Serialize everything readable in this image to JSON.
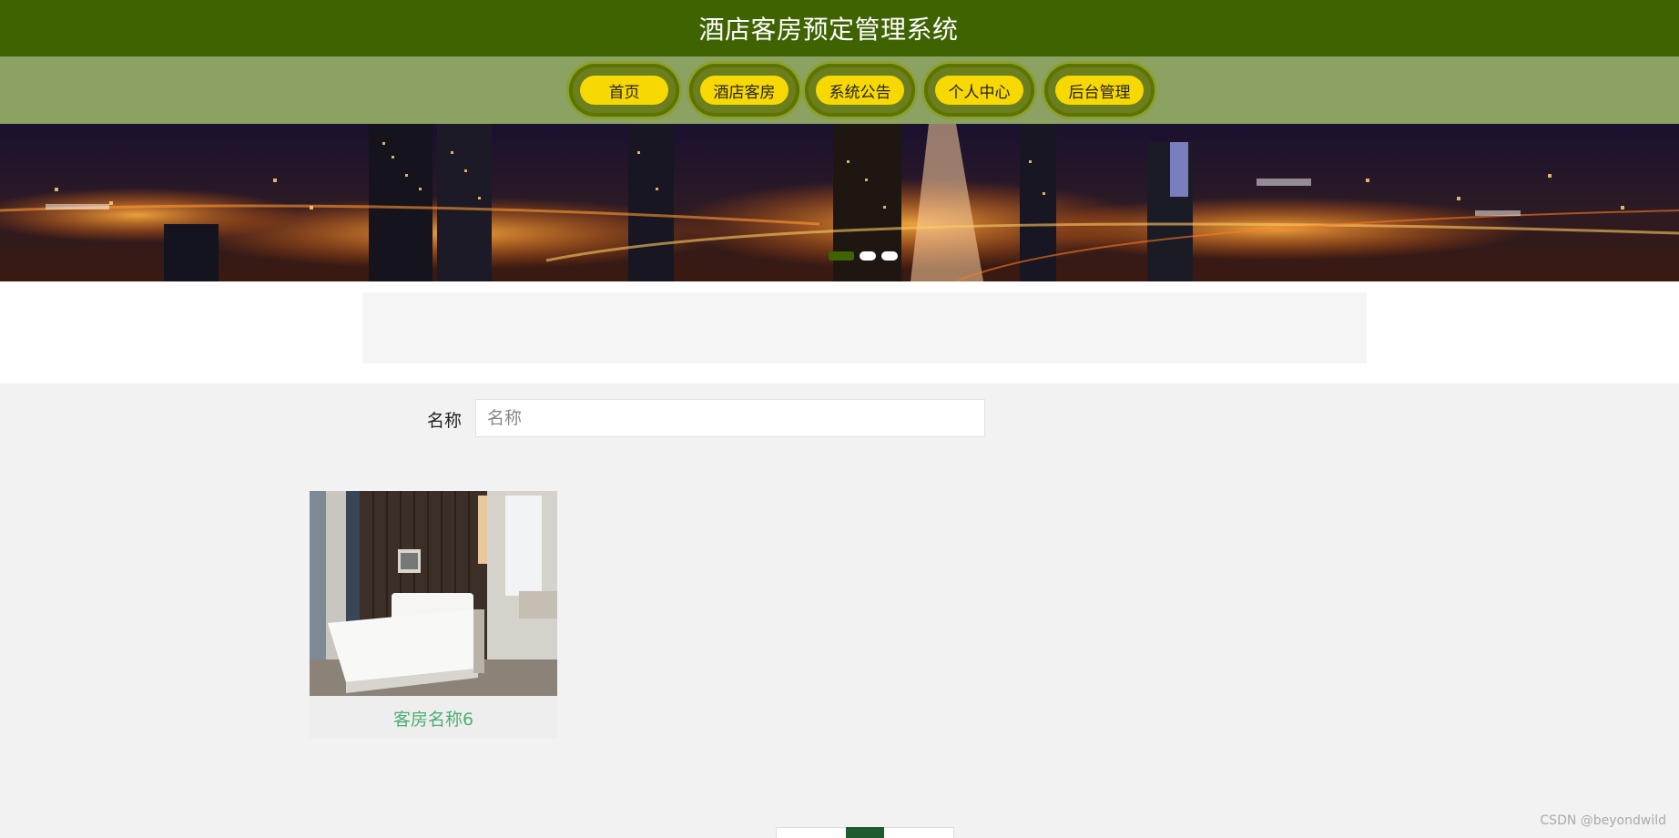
{
  "header": {
    "title": "酒店客房预定管理系统"
  },
  "nav": {
    "items": [
      {
        "label": "首页"
      },
      {
        "label": "酒店客房"
      },
      {
        "label": "系统公告"
      },
      {
        "label": "个人中心"
      },
      {
        "label": "后台管理"
      }
    ]
  },
  "banner": {
    "slide_count": 3,
    "active_slide": 1
  },
  "search": {
    "label": "名称",
    "placeholder": "名称",
    "value": ""
  },
  "rooms": [
    {
      "name": "客房名称6"
    }
  ],
  "pagination": {
    "current_page": 1
  },
  "watermark": "CSDN @beyondwild",
  "colors": {
    "header_bg": "#3f6300",
    "nav_bg": "#8ba263",
    "nav_pill": "#f7d800",
    "room_name": "#4caf72",
    "active_page": "#1d5c2c"
  }
}
